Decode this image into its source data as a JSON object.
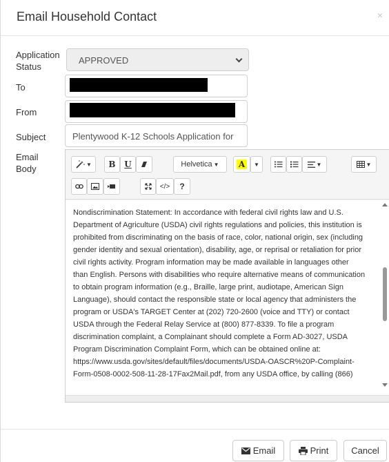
{
  "dialog": {
    "title": "Email Household Contact",
    "close_glyph": "×"
  },
  "form": {
    "status_label_line1": "Application",
    "status_label_line2": "Status",
    "status_value": "APPROVED",
    "to_label": "To",
    "from_label": "From",
    "subject_label": "Subject",
    "subject_value": "Plentywood K-12 Schools Application for",
    "body_label_line1": "Email",
    "body_label_line2": "Body"
  },
  "toolbar": {
    "font_name": "Helvetica",
    "help_label": "?",
    "icons": [
      "magic-wand-icon",
      "bold-icon",
      "underline-icon",
      "eraser-icon",
      "font-name-dropdown",
      "text-color-icon",
      "unordered-list-icon",
      "ordered-list-icon",
      "paragraph-align-icon",
      "table-icon",
      "link-icon",
      "picture-icon",
      "video-icon",
      "fullscreen-icon",
      "code-view-icon",
      "help-icon"
    ]
  },
  "editor": {
    "lines": [
      "Nondiscrimination Statement: In accordance with federal civil rights law and U.S.",
      "Department of Agriculture (USDA) civil rights regulations and policies, this institution is",
      "prohibited from discriminating on the basis of race, color, national origin, sex (including",
      "gender identity and sexual orientation), disability, age, or reprisal or retaliation for prior",
      "civil rights activity. Program information may be made available in languages other",
      "than English. Persons with disabilities who require alternative means of communication",
      "to obtain program information (e.g., Braille, large print, audiotape, American Sign",
      "Language), should contact the responsible state or local agency that administers the",
      "program or USDA's TARGET Center at (202) 720-2600 (voice and TTY) or contact",
      "USDA through the Federal Relay Service at (800) 877-8339. To file a program",
      "discrimination complaint, a Complainant should complete a Form AD-3027, USDA",
      "Program Discrimination Complaint Form, which can be obtained online at:",
      "https://www.usda.gov/sites/default/files/documents/USDA-OASCR%20P-Complaint-",
      "Form-0508-0002-508-11-28-17Fax2Mail.pdf, from any USDA office, by calling (866)"
    ]
  },
  "footer": {
    "email_label": "Email",
    "print_label": "Print",
    "cancel_label": "Cancel"
  }
}
